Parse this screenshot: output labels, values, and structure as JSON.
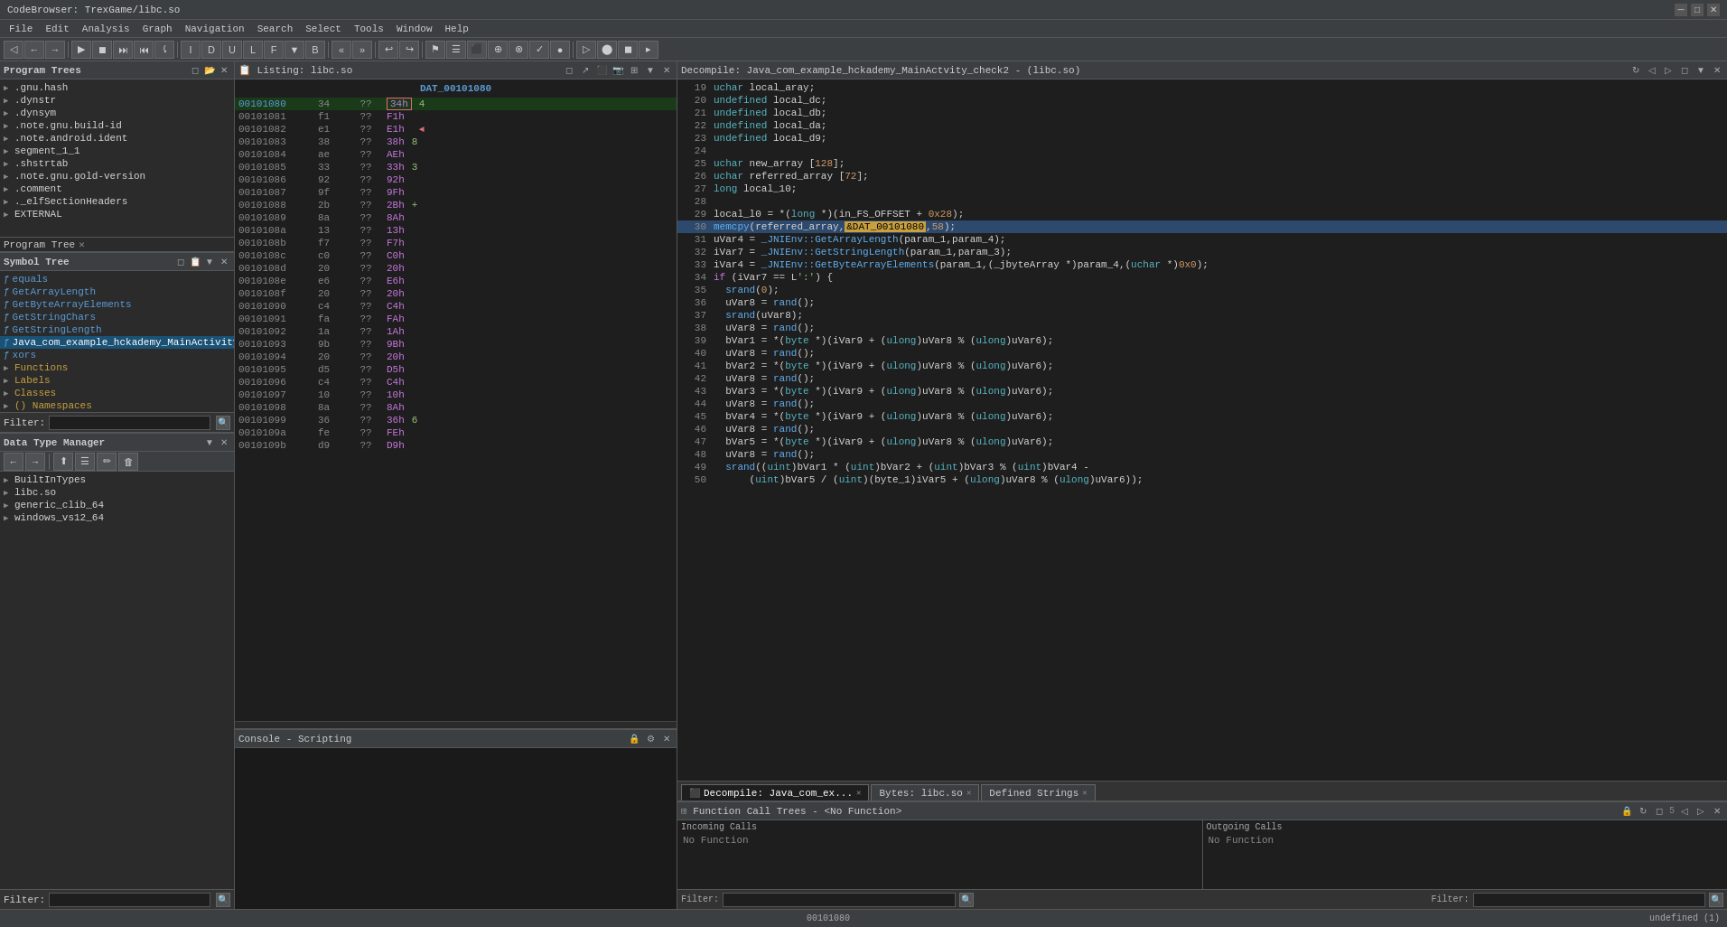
{
  "titlebar": {
    "title": "CodeBrowser: TrexGame/libc.so",
    "minimize": "─",
    "maximize": "□",
    "close": "✕"
  },
  "menubar": {
    "items": [
      "File",
      "Edit",
      "Analysis",
      "Graph",
      "Navigation",
      "Search",
      "Select",
      "Tools",
      "Window",
      "Help"
    ]
  },
  "panels": {
    "program_trees": {
      "title": "Program Trees",
      "program_tree_label": "Program Tree ✕",
      "items": [
        ".gnu.hash",
        ".dynstr",
        ".dynsym",
        ".note.gnu.build-id",
        ".note.android.ident",
        "segment_1_1",
        ".shstrtab",
        ".note.gnu.gold-version",
        ".comment",
        "._elfSectionHeaders",
        "EXTERNAL"
      ]
    },
    "symbol_tree": {
      "title": "Symbol Tree",
      "functions": [
        "equals",
        "GetArrayLength",
        "GetByteArrayElements",
        "GetStringChars",
        "GetStringLength",
        "Java_com_example_hckademy_MainActivity_check2",
        "xors"
      ],
      "groups": [
        "Functions",
        "Labels",
        "Classes",
        "() Namespaces"
      ]
    },
    "data_type_mgr": {
      "title": "Data Type Manager",
      "items": [
        "BuiltInTypes",
        "libc.so",
        "generic_clib_64",
        "windows_vs12_64"
      ]
    },
    "listing": {
      "title": "Listing: libc.so",
      "center_label": "DAT_00101080",
      "rows": [
        {
          "addr": "00101080",
          "hex1": "34",
          "op": "??",
          "hex2": "34h",
          "extra": "4"
        },
        {
          "addr": "00101081",
          "hex1": "f1",
          "op": "??",
          "hex2": "F1h",
          "extra": ""
        },
        {
          "addr": "00101082",
          "hex1": "e1",
          "op": "??",
          "hex2": "E1h",
          "extra": ""
        },
        {
          "addr": "00101083",
          "hex1": "38",
          "op": "??",
          "hex2": "38h",
          "extra": "8"
        },
        {
          "addr": "00101084",
          "hex1": "ae",
          "op": "??",
          "hex2": "AEh",
          "extra": ""
        },
        {
          "addr": "00101085",
          "hex1": "33",
          "op": "??",
          "hex2": "33h",
          "extra": "3"
        },
        {
          "addr": "00101086",
          "hex1": "92",
          "op": "??",
          "hex2": "92h",
          "extra": ""
        },
        {
          "addr": "00101087",
          "hex1": "9f",
          "op": "??",
          "hex2": "9Fh",
          "extra": ""
        },
        {
          "addr": "00101088",
          "hex1": "2b",
          "op": "??",
          "hex2": "2Bh",
          "extra": "+"
        },
        {
          "addr": "00101089",
          "hex1": "8a",
          "op": "??",
          "hex2": "8Ah",
          "extra": ""
        },
        {
          "addr": "0010108a",
          "hex1": "13",
          "op": "??",
          "hex2": "13h",
          "extra": ""
        },
        {
          "addr": "0010108b",
          "hex1": "f7",
          "op": "??",
          "hex2": "F7h",
          "extra": ""
        },
        {
          "addr": "0010108c",
          "hex1": "c0",
          "op": "??",
          "hex2": "C0h",
          "extra": ""
        },
        {
          "addr": "0010108d",
          "hex1": "20",
          "op": "??",
          "hex2": "20h",
          "extra": ""
        },
        {
          "addr": "0010108e",
          "hex1": "e6",
          "op": "??",
          "hex2": "E6h",
          "extra": ""
        },
        {
          "addr": "0010108f",
          "hex1": "20",
          "op": "??",
          "hex2": "20h",
          "extra": ""
        },
        {
          "addr": "00101090",
          "hex1": "c4",
          "op": "??",
          "hex2": "C4h",
          "extra": ""
        },
        {
          "addr": "00101091",
          "hex1": "fa",
          "op": "??",
          "hex2": "FAh",
          "extra": ""
        },
        {
          "addr": "00101092",
          "hex1": "1a",
          "op": "??",
          "hex2": "1Ah",
          "extra": ""
        },
        {
          "addr": "00101093",
          "hex1": "9b",
          "op": "??",
          "hex2": "9Bh",
          "extra": ""
        },
        {
          "addr": "00101094",
          "hex1": "20",
          "op": "??",
          "hex2": "20h",
          "extra": ""
        },
        {
          "addr": "00101095",
          "hex1": "d5",
          "op": "??",
          "hex2": "D5h",
          "extra": ""
        },
        {
          "addr": "00101096",
          "hex1": "c4",
          "op": "??",
          "hex2": "C4h",
          "extra": ""
        },
        {
          "addr": "00101097",
          "hex1": "10",
          "op": "??",
          "hex2": "10h",
          "extra": ""
        },
        {
          "addr": "00101098",
          "hex1": "8a",
          "op": "??",
          "hex2": "8Ah",
          "extra": ""
        },
        {
          "addr": "00101099",
          "hex1": "36",
          "op": "??",
          "hex2": "36h",
          "extra": "6"
        },
        {
          "addr": "0010109a",
          "hex1": "fe",
          "op": "??",
          "hex2": "FEh",
          "extra": ""
        },
        {
          "addr": "0010109b",
          "hex1": "d9",
          "op": "??",
          "hex2": "D9h",
          "extra": ""
        }
      ]
    },
    "decompile": {
      "title": "Decompile: Java_com_example_hckademy_MainActvity_check2 - (libc.so)",
      "tabs": [
        {
          "label": "Decompile: Java_com_ex...",
          "close": true,
          "active": true
        },
        {
          "label": "Bytes: libc.so",
          "close": true,
          "active": false
        },
        {
          "label": "Defined Strings",
          "close": true,
          "active": false
        }
      ],
      "lines": [
        {
          "num": "19",
          "code": "uchar local_aray;"
        },
        {
          "num": "20",
          "code": "undefined local_dc;"
        },
        {
          "num": "21",
          "code": "undefined local_db;"
        },
        {
          "num": "22",
          "code": "undefined local_da;"
        },
        {
          "num": "23",
          "code": "undefined local_d9;"
        },
        {
          "num": "24",
          "code": ""
        },
        {
          "num": "25",
          "code": "uchar new_array [128];"
        },
        {
          "num": "26",
          "code": "uchar referred_array [72];"
        },
        {
          "num": "27",
          "code": "long local_10;"
        },
        {
          "num": "28",
          "code": ""
        },
        {
          "num": "29",
          "code": "local_l0 = *(long *)(in_FS_OFFSET + 0x28);"
        },
        {
          "num": "30",
          "code": "memcpy(referred_array,&DAT_00101080,58);"
        },
        {
          "num": "31",
          "code": "uVar4 = _JNIEnv::GetArrayLength(param_1,param_4);"
        },
        {
          "num": "32",
          "code": "iVar7 = _JNIEnv::GetStringLength(param_1,param_3);"
        },
        {
          "num": "33",
          "code": "iVar4 = _JNIEnv::GetByteArrayElements(param_1,(_jbyteArray *)param_4,(uchar *)0x0);"
        },
        {
          "num": "34",
          "code": "if (iVar7 == L':') {"
        },
        {
          "num": "35",
          "code": "  srand(0);"
        },
        {
          "num": "36",
          "code": "  uVar8 = rand();"
        },
        {
          "num": "37",
          "code": "  srand(uVar8);"
        },
        {
          "num": "38",
          "code": "  uVar8 = rand();"
        },
        {
          "num": "39",
          "code": "  bVar1 = *(byte *)(iVar9 + (ulong)uVar8 % (ulong)uVar6);"
        },
        {
          "num": "40",
          "code": "  uVar8 = rand();"
        },
        {
          "num": "41",
          "code": "  bVar2 = *(byte *)(iVar9 + (ulong)uVar8 % (ulong)uVar6);"
        },
        {
          "num": "42",
          "code": "  uVar8 = rand();"
        },
        {
          "num": "43",
          "code": "  bVar3 = *(byte *)(iVar9 + (ulong)uVar8 % (ulong)uVar6);"
        },
        {
          "num": "44",
          "code": "  uVar8 = rand();"
        },
        {
          "num": "45",
          "code": "  bVar4 = *(byte *)(iVar9 + (ulong)uVar8 % (ulong)uVar6);"
        },
        {
          "num": "46",
          "code": "  uVar8 = rand();"
        },
        {
          "num": "47",
          "code": "  bVar5 = *(byte *)(iVar9 + (ulong)uVar8 % (ulong)uVar6);"
        },
        {
          "num": "48",
          "code": "  uVar8 = rand();"
        },
        {
          "num": "49",
          "code": "  srand((uint)bVar1 * (uint)bVar2 + (uint)bVar3 % (uint)bVar4 -"
        },
        {
          "num": "50",
          "code": "        (uint)bVar5 / (uint)(byte_1)iVar5 + (ulong)uVar8 % (ulong)uVar6));"
        }
      ]
    },
    "console": {
      "title": "Console - Scripting"
    },
    "fct": {
      "title": "Function Call Trees - <No Function>",
      "incoming_label": "Incoming Calls",
      "incoming_item": "No Function",
      "outgoing_label": "Outgoing Calls",
      "outgoing_item": "No Function"
    }
  },
  "statusbar": {
    "left": "",
    "addr": "00101080",
    "right": "undefined (1)"
  },
  "filter": {
    "label": "Filter:",
    "placeholder": ""
  },
  "icons": {
    "expand": "▶",
    "collapse": "▼",
    "close": "✕",
    "arrow": "→",
    "settings": "⚙",
    "refresh": "↻",
    "nav_back": "←",
    "nav_forward": "→",
    "folder": "📁",
    "function": "ƒ"
  }
}
